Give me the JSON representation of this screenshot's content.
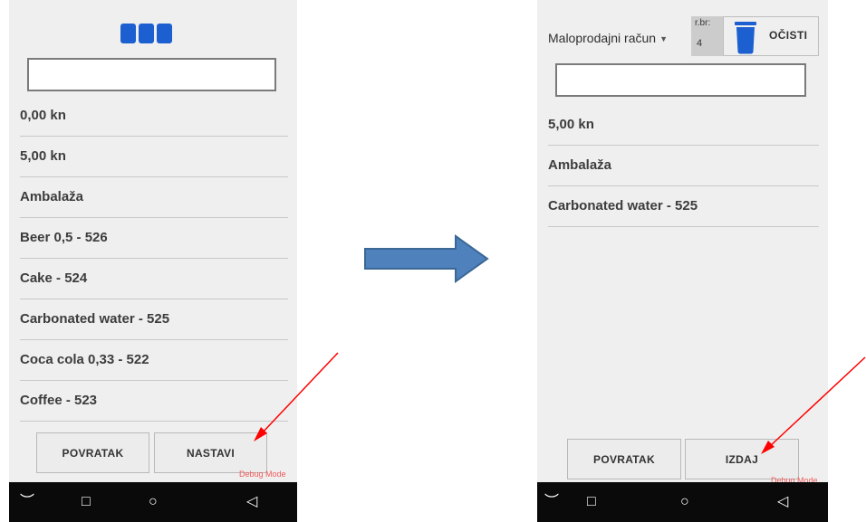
{
  "before": {
    "amounts": [
      "0,00 kn",
      "5,00 kn"
    ],
    "items": [
      "Ambalaža",
      "Beer 0,5 - 526",
      "Cake - 524",
      "Carbonated water - 525",
      "Coca cola 0,33 - 522",
      "Coffee - 523"
    ],
    "back_label": "POVRATAK",
    "continue_label": "NASTAVI",
    "debug_text": "Debug Mode"
  },
  "after": {
    "doc_type": "Maloprodajni račun",
    "receipt_no_label": "r.br:",
    "receipt_no_value": "4",
    "clear_label": "OČISTI",
    "amount": "5,00 kn",
    "items": [
      "Ambalaža",
      "Carbonated water - 525"
    ],
    "back_label": "POVRATAK",
    "issue_label": "IZDAJ",
    "debug_text": "Debug Mode"
  },
  "nav_icons": {
    "down": "︶",
    "recent": "□",
    "home": "○",
    "back": "◁"
  },
  "colors": {
    "accent_blue": "#1c5fd0",
    "flow_arrow": "#4f81bd",
    "annotation_red": "#ff0000",
    "debug_red": "#f05a5a"
  }
}
